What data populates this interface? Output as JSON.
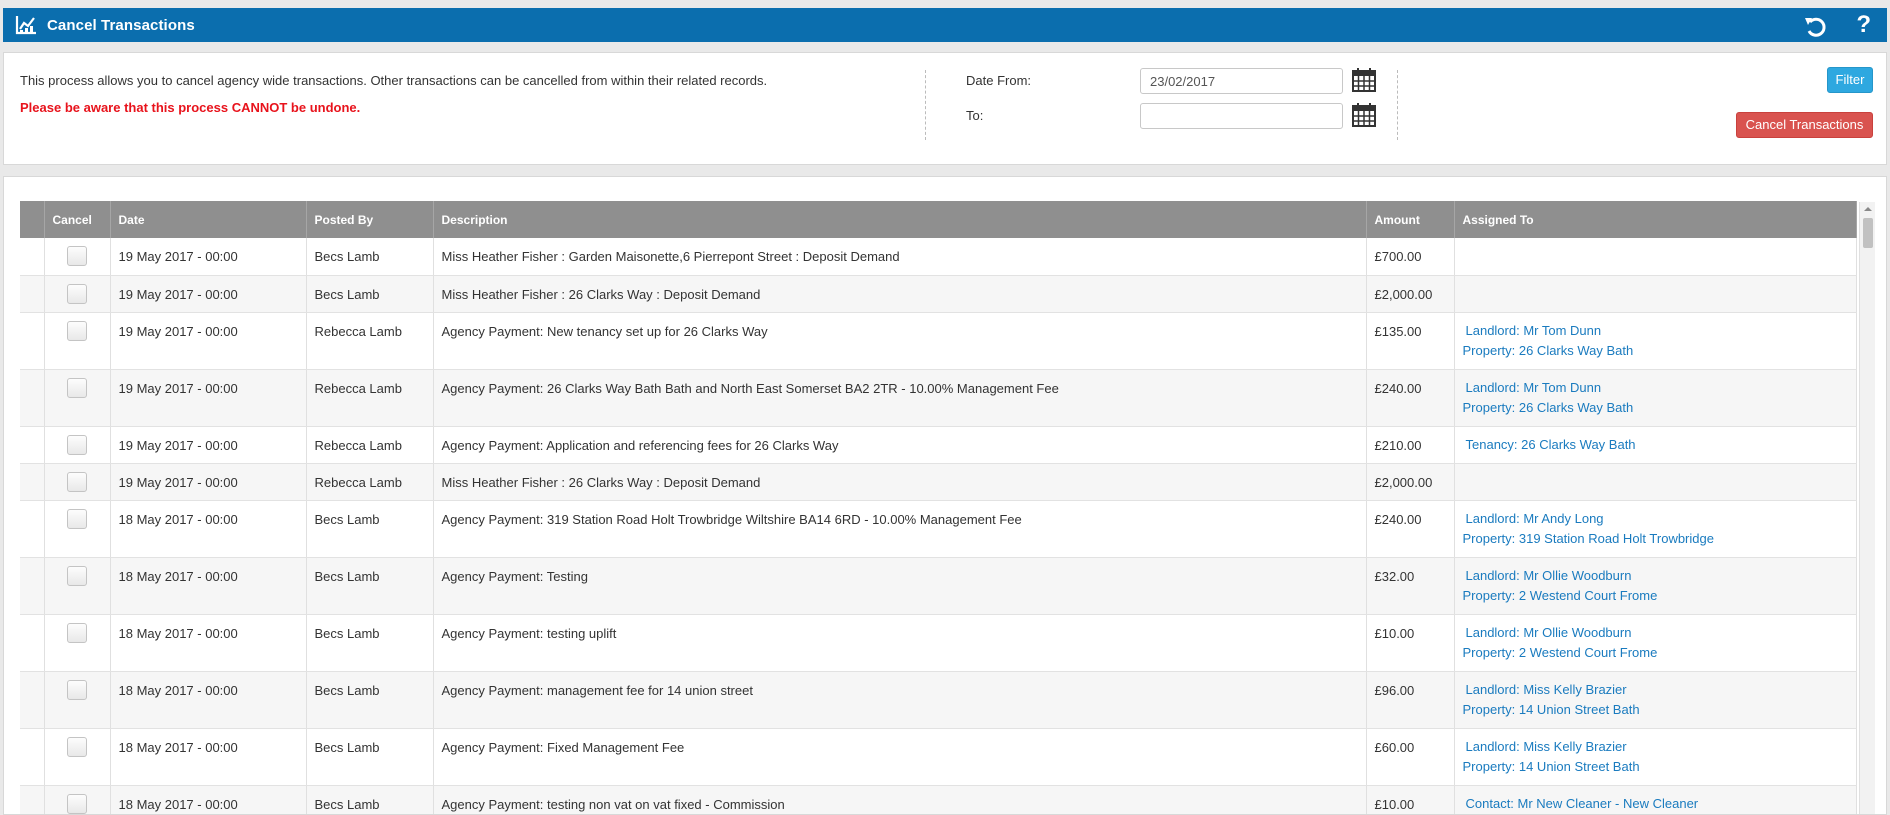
{
  "titlebar": {
    "title": "Cancel Transactions",
    "icon": "chart-icon",
    "undo_icon": "undo-icon",
    "help_label": "?"
  },
  "info": {
    "description": "This process allows you to cancel agency wide transactions. Other transactions can be cancelled from within their related records.",
    "warning": "Please be aware that this process CANNOT be undone."
  },
  "filter": {
    "date_from_label": "Date From:",
    "date_from_value": "23/02/2017",
    "to_label": "To:",
    "to_value": "",
    "filter_button": "Filter",
    "cancel_button": "Cancel Transactions"
  },
  "table": {
    "columns": [
      "",
      "Cancel",
      "Date",
      "Posted By",
      "Description",
      "Amount",
      "Assigned To"
    ],
    "rows": [
      {
        "date": "19 May 2017 - 00:00",
        "posted_by": "Becs Lamb",
        "description": "Miss Heather Fisher : Garden Maisonette,6 Pierrepont Street : Deposit Demand",
        "amount": "£700.00",
        "assigned": []
      },
      {
        "date": "19 May 2017 - 00:00",
        "posted_by": "Becs Lamb",
        "description": "Miss Heather Fisher : 26 Clarks Way : Deposit Demand",
        "amount": "£2,000.00",
        "assigned": []
      },
      {
        "date": "19 May 2017 - 00:00",
        "posted_by": "Rebecca Lamb",
        "description": "Agency Payment: New tenancy set up for 26 Clarks Way",
        "amount": "£135.00",
        "assigned": [
          "Landlord: Mr Tom Dunn",
          "Property: 26 Clarks Way Bath"
        ]
      },
      {
        "date": "19 May 2017 - 00:00",
        "posted_by": "Rebecca Lamb",
        "description": "Agency Payment: 26 Clarks Way Bath Bath and North East Somerset BA2 2TR - 10.00% Management Fee",
        "amount": "£240.00",
        "assigned": [
          "Landlord: Mr Tom Dunn",
          "Property: 26 Clarks Way Bath"
        ]
      },
      {
        "date": "19 May 2017 - 00:00",
        "posted_by": "Rebecca Lamb",
        "description": "Agency Payment: Application and referencing fees for 26 Clarks Way",
        "amount": "£210.00",
        "assigned": [
          "Tenancy: 26 Clarks Way Bath"
        ]
      },
      {
        "date": "19 May 2017 - 00:00",
        "posted_by": "Rebecca Lamb",
        "description": "Miss Heather Fisher : 26 Clarks Way : Deposit Demand",
        "amount": "£2,000.00",
        "assigned": []
      },
      {
        "date": "18 May 2017 - 00:00",
        "posted_by": "Becs Lamb",
        "description": "Agency Payment: 319 Station Road Holt Trowbridge Wiltshire BA14 6RD - 10.00% Management Fee",
        "amount": "£240.00",
        "assigned": [
          "Landlord: Mr Andy Long",
          "Property: 319 Station Road Holt Trowbridge"
        ]
      },
      {
        "date": "18 May 2017 - 00:00",
        "posted_by": "Becs Lamb",
        "description": "Agency Payment: Testing",
        "amount": "£32.00",
        "assigned": [
          "Landlord: Mr Ollie Woodburn",
          "Property: 2 Westend Court Frome"
        ]
      },
      {
        "date": "18 May 2017 - 00:00",
        "posted_by": "Becs Lamb",
        "description": "Agency Payment: testing uplift",
        "amount": "£10.00",
        "assigned": [
          "Landlord: Mr Ollie Woodburn",
          "Property: 2 Westend Court Frome"
        ]
      },
      {
        "date": "18 May 2017 - 00:00",
        "posted_by": "Becs Lamb",
        "description": "Agency Payment: management fee for 14 union street",
        "amount": "£96.00",
        "assigned": [
          "Landlord: Miss Kelly Brazier",
          "Property: 14 Union Street Bath"
        ]
      },
      {
        "date": "18 May 2017 - 00:00",
        "posted_by": "Becs Lamb",
        "description": "Agency Payment: Fixed Management Fee",
        "amount": "£60.00",
        "assigned": [
          "Landlord: Miss Kelly Brazier",
          "Property: 14 Union Street Bath"
        ]
      },
      {
        "date": "18 May 2017 - 00:00",
        "posted_by": "Becs Lamb",
        "description": "Agency Payment: testing non vat on vat fixed - Commission",
        "amount": "£10.00",
        "assigned": [
          "Contact: Mr New Cleaner - New Cleaner"
        ]
      }
    ]
  }
}
